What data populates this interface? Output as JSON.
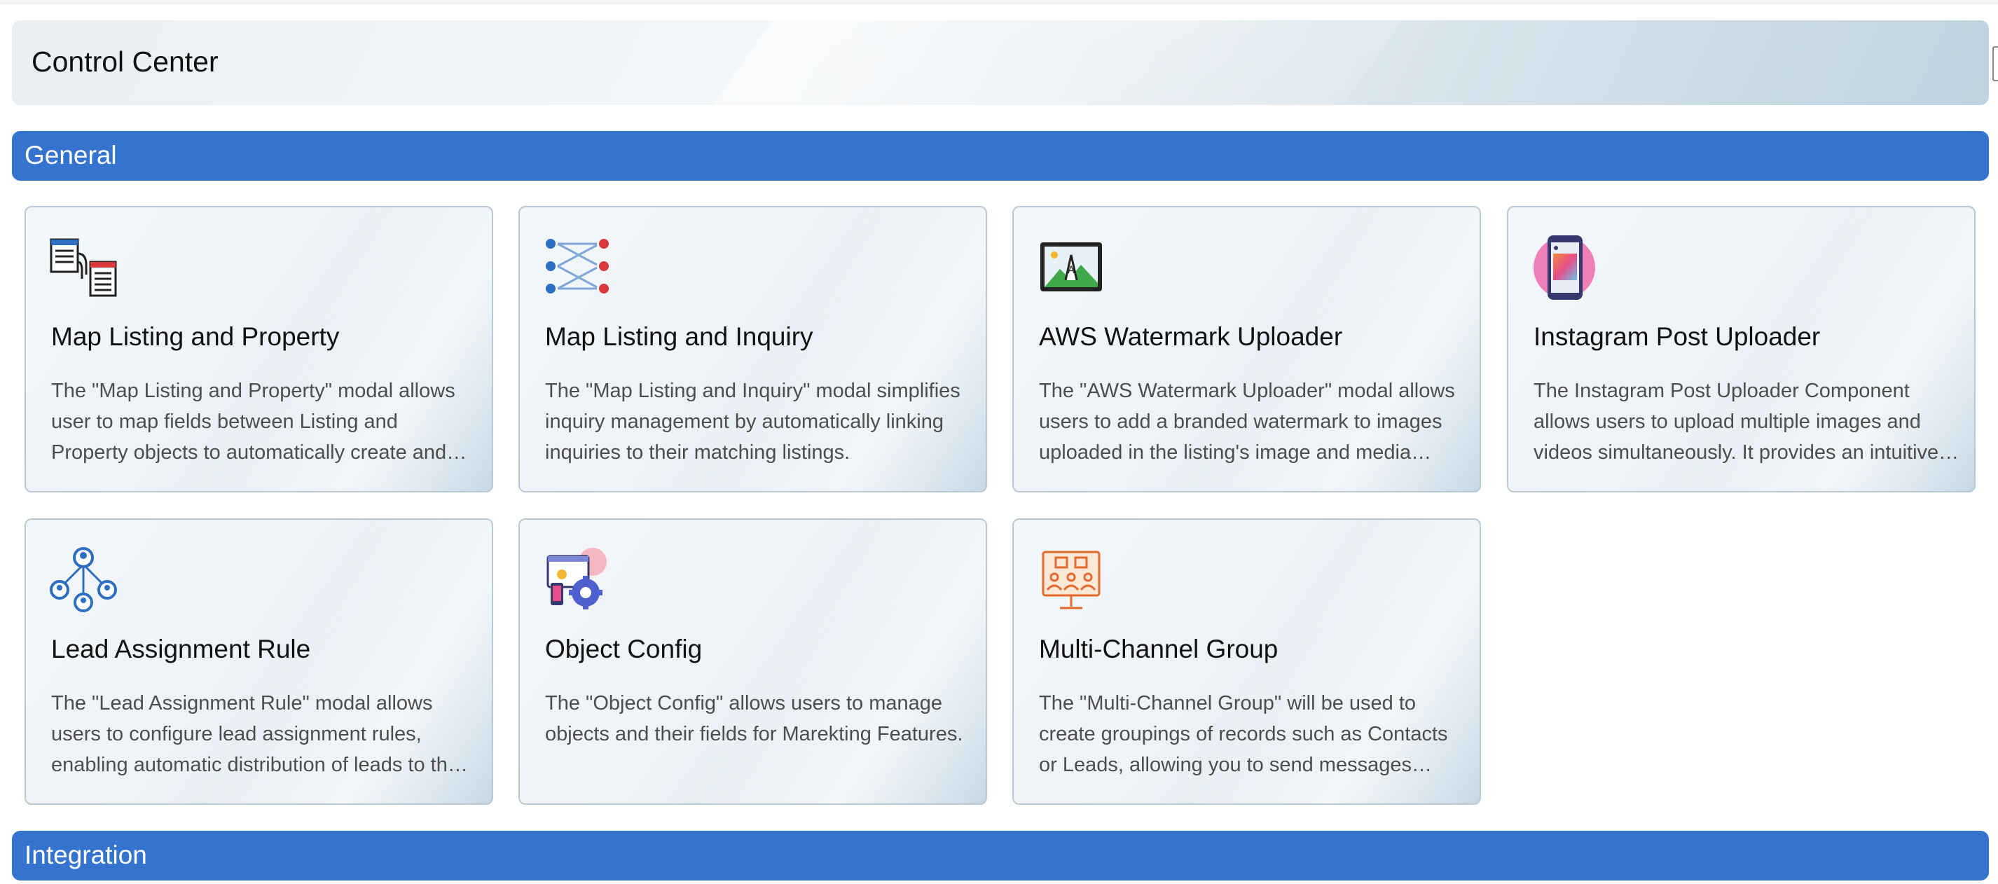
{
  "header": {
    "title": "Control Center"
  },
  "sections": [
    {
      "label": "General"
    },
    {
      "label": "Integration"
    }
  ],
  "cards": [
    {
      "title": "Map Listing and Property",
      "icon": "map-listing-property-icon",
      "description": "The \"Map Listing and Property\" modal allows user to map fields between Listing and Property objects to automatically create and link property records."
    },
    {
      "title": "Map Listing and Inquiry",
      "icon": "map-listing-inquiry-icon",
      "description": "The \"Map Listing and Inquiry\" modal simplifies inquiry management by automatically linking inquiries to their matching listings."
    },
    {
      "title": "AWS Watermark Uploader",
      "icon": "aws-watermark-icon",
      "description": "The \"AWS Watermark Uploader\" modal allows users to add a branded watermark to images uploaded in the listing's image and media section."
    },
    {
      "title": "Instagram Post Uploader",
      "icon": "instagram-post-icon",
      "description": "The Instagram Post Uploader Component allows users to upload multiple images and videos simultaneously. It provides an intuitive interface for publishing."
    },
    {
      "title": "Lead Assignment Rule",
      "icon": "lead-assignment-icon",
      "description": "The \"Lead Assignment Rule\" modal allows users to configure lead assignment rules, enabling automatic distribution of leads to the right agents."
    },
    {
      "title": "Object Config",
      "icon": "object-config-icon",
      "description": "The \"Object Config\" allows users to manage objects and their fields for Marekting Features."
    },
    {
      "title": "Multi-Channel Group",
      "icon": "multi-channel-group-icon",
      "description": "The \"Multi-Channel Group\" will be used to create groupings of records such as Contacts or Leads, allowing you to send messages across channels."
    }
  ],
  "colors": {
    "section_bar": "#3474ce",
    "card_border": "#b9c8d5",
    "text_primary": "#111111",
    "text_secondary": "#4d4d4d"
  }
}
